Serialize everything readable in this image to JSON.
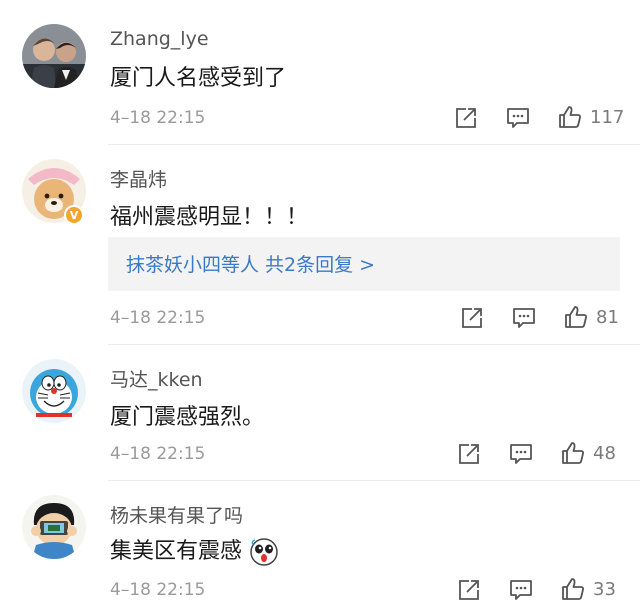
{
  "comments": [
    {
      "username": "Zhang_lye",
      "text": "厦门人名感受到了",
      "time": "4–18 22:15",
      "likes": "117",
      "avatar_icon": "two-men-photo-avatar"
    },
    {
      "username": "李晶炜",
      "text": "福州震感明显！！！",
      "time": "4–18 22:15",
      "likes": "81",
      "avatar_icon": "shiba-dog-avatar",
      "verified_badge": "verified-v-icon",
      "badge_letter": "V",
      "replies_text": "抹茶妖小四等人 共2条回复 >"
    },
    {
      "username": "马达_kken",
      "text": "厦门震感强烈。",
      "time": "4–18 22:15",
      "likes": "48",
      "avatar_icon": "doraemon-avatar"
    },
    {
      "username": "杨未果有果了吗",
      "text": "集美区有震感",
      "time": "4–18 22:15",
      "likes": "33",
      "avatar_icon": "cartoon-boy-avatar",
      "emoji_icon": "scared-face-emoji"
    }
  ],
  "colors": {
    "link": "#3a7ac8",
    "username": "#555555",
    "meta": "#9a9a9a",
    "badge": "#f3a62e"
  }
}
